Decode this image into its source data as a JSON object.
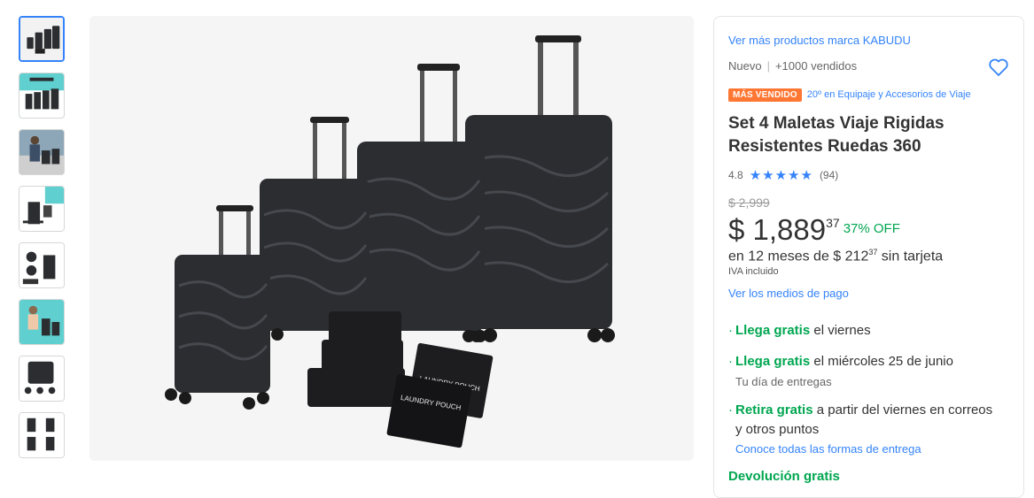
{
  "thumbnails": [
    {
      "name": "thumbnail-luggage-set"
    },
    {
      "name": "thumbnail-luggage-set-infographic"
    },
    {
      "name": "thumbnail-luggage-in-use"
    },
    {
      "name": "thumbnail-luggage-extendable"
    },
    {
      "name": "thumbnail-luggage-details"
    },
    {
      "name": "thumbnail-luggage-lifestyle"
    },
    {
      "name": "thumbnail-luggage-features"
    },
    {
      "name": "thumbnail-luggage-colors"
    }
  ],
  "product": {
    "brand_link": "Ver más productos marca KABUDU",
    "condition": "Nuevo",
    "sold": "+1000 vendidos",
    "badge": "MÁS VENDIDO",
    "badge_rank": "20º en Equipaje y Accesorios de Viaje",
    "title": "Set 4 Maletas Viaje Rigidas Resistentes Ruedas 360",
    "rating": "4.8",
    "stars": "★★★★★",
    "reviews": "(94)",
    "old_price": "$ 2,999",
    "price_main": "$ 1,889",
    "price_cents": "37",
    "discount": "37% OFF",
    "installments_prefix": "en 12 meses de $ 212",
    "installments_cents": "37",
    "installments_suffix": " sin tarjeta",
    "iva": "IVA incluido",
    "payment_link": "Ver los medios de pago"
  },
  "shipping": {
    "bullet": "·",
    "option1_green": "Llega gratis",
    "option1_rest": " el viernes",
    "option2_green": "Llega gratis",
    "option2_rest": " el miércoles 25 de junio",
    "option2_sub": "Tu día de entregas",
    "option3_green": "Retira gratis",
    "option3_rest": " a partir del viernes en correos",
    "option3_line2": "y otros puntos",
    "all_options_link": "Conoce todas las formas de entrega",
    "returns": "Devolución gratis"
  },
  "image_text": {
    "pouch_label": "LAUNDRY POUCH"
  },
  "colors": {
    "accent": "#3483fa",
    "green": "#00a650",
    "badge": "#ff7733",
    "luggage": "#2b2d30"
  }
}
